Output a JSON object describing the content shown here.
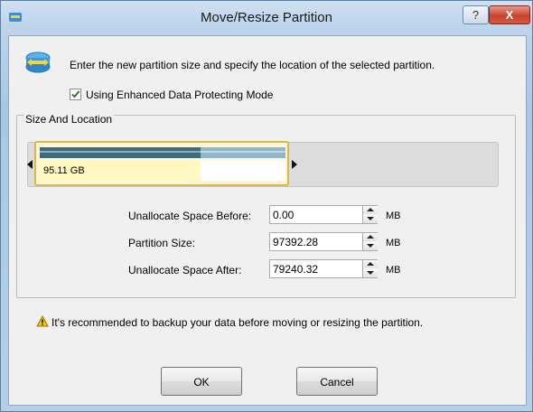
{
  "window": {
    "title": "Move/Resize Partition",
    "help_label": "?",
    "close_label": "X"
  },
  "intro_text": "Enter the new partition size and specify the location of the selected partition.",
  "enhanced_mode": {
    "label": "Using Enhanced Data Protecting Mode",
    "checked": true
  },
  "group_label": "Size And Location",
  "partition": {
    "size_label": "95.11 GB",
    "used_fraction": 0.655
  },
  "fields": [
    {
      "label": "Unallocate Space Before:",
      "value": "0.00",
      "unit": "MB"
    },
    {
      "label": "Partition Size:",
      "value": "97392.28",
      "unit": "MB"
    },
    {
      "label": "Unallocate Space After:",
      "value": "79240.32",
      "unit": "MB"
    }
  ],
  "warning": "It's recommended to backup your data before moving or resizing the partition.",
  "buttons": {
    "ok": "OK",
    "cancel": "Cancel"
  },
  "colors": {
    "accent_border": "#e0b64a",
    "close_red": "#c8432f"
  },
  "icons": [
    "app-icon",
    "partition-resize-icon",
    "checkmark-icon",
    "warning-icon"
  ]
}
